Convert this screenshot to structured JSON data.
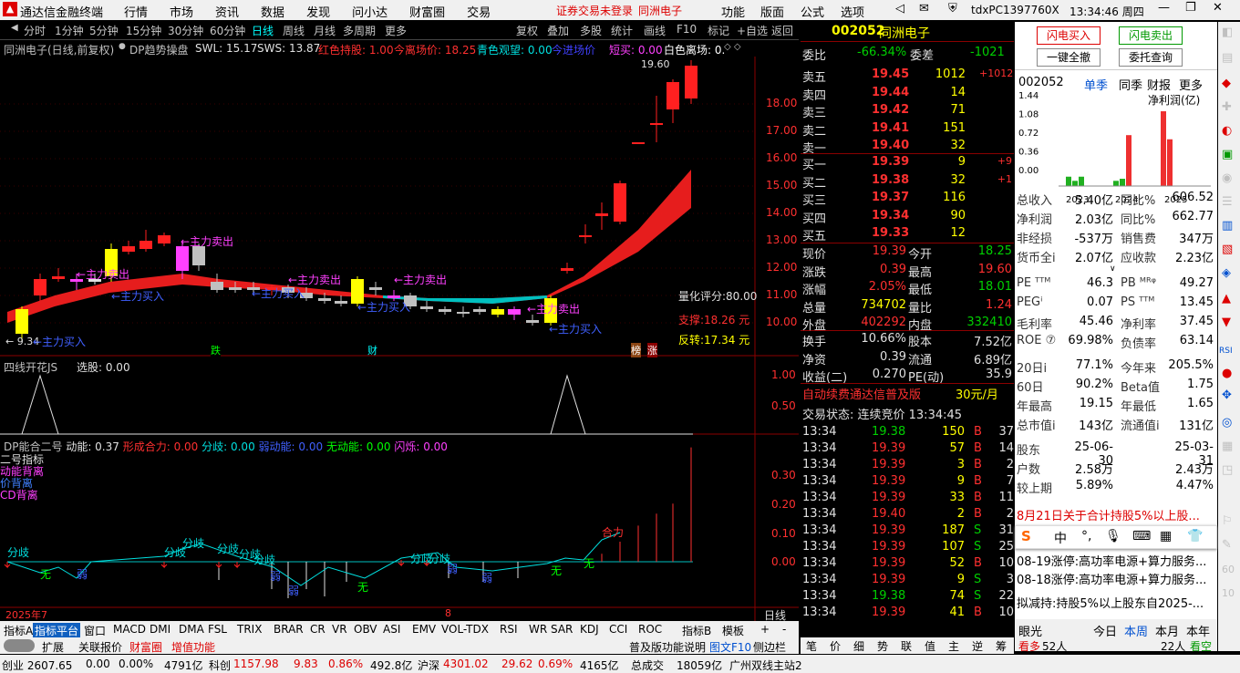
{
  "app": {
    "title": "通达信金融终端",
    "menus": [
      "行情",
      "市场",
      "资讯",
      "数据",
      "发现",
      "问小达",
      "财富圈",
      "交易"
    ],
    "alert": "证券交易未登录",
    "stock_name_top": "同洲电子",
    "right_menus": [
      "功能",
      "版面",
      "公式",
      "选项"
    ],
    "account": "tdxPC1397760X",
    "time": "13:34:46 周四"
  },
  "periods": [
    "分时",
    "1分钟",
    "5分钟",
    "15分钟",
    "30分钟",
    "60分钟",
    "日线",
    "周线",
    "月线",
    "多周期",
    "更多"
  ],
  "toolbar": [
    "复权",
    "叠加",
    "多股",
    "统计",
    "画线",
    "F10",
    "标记",
    "+自选",
    "返回"
  ],
  "chart_info": {
    "name": "同洲电子(日线,前复权)",
    "indicator": "DP趋势操盘",
    "swl": "SWL: 15.17",
    "sws": "SWS: 13.87",
    "red_hold": "红色持股: 1.00",
    "today_price": "今离场价: 18.25",
    "cyan_watch": "青色观望: 0.00",
    "today_entry": "今进场价",
    "short_buy": "短买: 0.00",
    "white_exit": "白色离场: 0."
  },
  "main_labels": {
    "score": "量化评分:80.00",
    "support": "支撑:18.26 元",
    "reverse": "反转:17.34 元",
    "low_label": "← 9.34",
    "high_label": "19.60",
    "die": "跌",
    "cai": "财",
    "bang": "榜",
    "zhang": "涨",
    "sell": "←主力卖出",
    "buy": "←主力买入"
  },
  "price_axis": [
    "18.00",
    "17.00",
    "16.00",
    "15.00",
    "14.00",
    "13.00",
    "12.00",
    "11.00",
    "10.00"
  ],
  "ind1": {
    "title": "四线开花JS",
    "sel": "选股: 0.00",
    "axis": [
      "1.00",
      "0.50"
    ]
  },
  "ind2": {
    "title": "DP能合二号",
    "power": "动能: 0.37",
    "form": "形成合力: 0.00",
    "diverge": "分歧: 0.00",
    "weak": "弱动能: 0.00",
    "none": "无动能: 0.00",
    "flash": "闪烁: 0.00",
    "axis": [
      "0.30",
      "0.20",
      "0.10",
      "0.00"
    ],
    "legend": [
      "二号指标",
      "动能背离",
      "价背离",
      "CD背离"
    ],
    "labels": {
      "fq": "分歧",
      "w": "无",
      "r": "弱",
      "hl": "合力"
    }
  },
  "date_axis": {
    "d1": "2025年7",
    "d2": "8",
    "period": "日线"
  },
  "quote": {
    "code": "002052",
    "name": "同洲电子",
    "weibi_label": "委比",
    "weibi": "-66.34%",
    "weicha_label": "委差",
    "weicha": "-1021",
    "asks": [
      {
        "l": "卖五",
        "p": "19.45",
        "v": "1012",
        "c": "+1012"
      },
      {
        "l": "卖四",
        "p": "19.44",
        "v": "14",
        "c": ""
      },
      {
        "l": "卖三",
        "p": "19.42",
        "v": "71",
        "c": ""
      },
      {
        "l": "卖二",
        "p": "19.41",
        "v": "151",
        "c": ""
      },
      {
        "l": "卖一",
        "p": "19.40",
        "v": "32",
        "c": ""
      }
    ],
    "bids": [
      {
        "l": "买一",
        "p": "19.39",
        "v": "9",
        "c": "+9"
      },
      {
        "l": "买二",
        "p": "19.38",
        "v": "32",
        "c": "+1"
      },
      {
        "l": "买三",
        "p": "19.37",
        "v": "116",
        "c": ""
      },
      {
        "l": "买四",
        "p": "19.34",
        "v": "90",
        "c": ""
      },
      {
        "l": "买五",
        "p": "19.33",
        "v": "12",
        "c": ""
      }
    ],
    "stats": [
      [
        "现价",
        "19.39",
        "今开",
        "18.25"
      ],
      [
        "涨跌",
        "0.39",
        "最高",
        "19.60"
      ],
      [
        "涨幅",
        "2.05%",
        "最低",
        "18.01"
      ],
      [
        "总量",
        "734702",
        "量比",
        "1.24"
      ],
      [
        "外盘",
        "402292",
        "内盘",
        "332410"
      ]
    ],
    "stats2": [
      [
        "换手",
        "10.66%",
        "股本",
        "7.52亿"
      ],
      [
        "净资",
        "0.39",
        "流通",
        "6.89亿"
      ],
      [
        "收益(二)",
        "0.270",
        "PE(动)",
        "35.9"
      ]
    ],
    "ad": "自动续费通达信普及版",
    "ad_price": "30元/月",
    "trade_state": "交易状态: 连续竞价 13:34:45",
    "ticks": [
      [
        "13:34",
        "19.38",
        "150",
        "B",
        "37"
      ],
      [
        "13:34",
        "19.39",
        "57",
        "B",
        "14"
      ],
      [
        "13:34",
        "19.39",
        "3",
        "B",
        "2"
      ],
      [
        "13:34",
        "19.39",
        "9",
        "B",
        "7"
      ],
      [
        "13:34",
        "19.39",
        "33",
        "B",
        "11"
      ],
      [
        "13:34",
        "19.40",
        "2",
        "B",
        "2"
      ],
      [
        "13:34",
        "19.39",
        "187",
        "S",
        "31"
      ],
      [
        "13:34",
        "19.39",
        "107",
        "S",
        "25"
      ],
      [
        "13:34",
        "19.39",
        "52",
        "B",
        "10"
      ],
      [
        "13:34",
        "19.39",
        "9",
        "S",
        "3"
      ],
      [
        "13:34",
        "19.38",
        "74",
        "S",
        "22"
      ],
      [
        "13:34",
        "19.39",
        "41",
        "B",
        "10"
      ]
    ],
    "tabs": [
      "笔",
      "价",
      "细",
      "势",
      "联",
      "值",
      "主",
      "逆",
      "筹"
    ]
  },
  "fin": {
    "btn_buy": "闪电买入",
    "btn_sell": "闪电卖出",
    "btn_cancel": "一键全撤",
    "btn_query": "委托查询",
    "code": "002052",
    "tabs": [
      "单季",
      "同季",
      "财报",
      "更多"
    ],
    "chart_title": "净利润(亿)",
    "yaxis": [
      "1.44",
      "1.08",
      "0.72",
      "0.36",
      "0.00"
    ],
    "years": [
      "2023",
      "2024",
      "2025"
    ],
    "chart_data": {
      "type": "bar",
      "title": "净利润(亿)",
      "categories": [
        "2023Q1",
        "2023Q2",
        "2023Q3",
        "2023Q4",
        "2024Q1",
        "2024Q2",
        "2024Q3",
        "2024Q4",
        "2025Q1",
        "2025Q2"
      ],
      "values": [
        0.18,
        0.1,
        0.18,
        0.0,
        0.1,
        0.14,
        0.98,
        0.0,
        1.44,
        0.9
      ],
      "ylim": [
        0,
        1.44
      ]
    },
    "rows": [
      [
        "总收入",
        "5.40亿",
        "同比%",
        "606.52"
      ],
      [
        "净利润",
        "2.03亿",
        "同比%",
        "662.77"
      ],
      [
        "非经损",
        "-537万",
        "销售费",
        "347万"
      ],
      [
        "货币全i",
        "2.07亿",
        "应收款",
        "2.23亿"
      ],
      [
        "PE ᵀᵀᴹ",
        "46.3",
        "PB ᴹᴿᵠ",
        "49.27"
      ],
      [
        "PEGⁱ",
        "0.07",
        "PS ᵀᵀᴹ",
        "13.45"
      ],
      [
        "毛利率",
        "45.46",
        "净利率",
        "37.45"
      ],
      [
        "ROE ⑦",
        "69.98%",
        "负债率",
        "63.14"
      ],
      [
        "20日i",
        "77.1%",
        "今年来",
        "205.5%"
      ],
      [
        "60日",
        "90.2%",
        "Beta值",
        "1.75"
      ],
      [
        "年最高",
        "19.15",
        "年最低",
        "1.65"
      ],
      [
        "总市值i",
        "143亿",
        "流通值i",
        "131亿"
      ],
      [
        "股东",
        "25-06-30",
        "",
        "25-03-31"
      ],
      [
        "户数",
        "2.58万",
        "",
        "2.43万"
      ],
      [
        "较上期",
        "5.89%",
        "",
        "4.47%"
      ]
    ],
    "news": [
      "8月21日关于合计持股5%以上股...",
      "08-19涨停:高功率电源+算力服务...",
      "08-18涨停:高功率电源+算力服务...",
      "拟减持:持股5%以上股东自2025-..."
    ],
    "bottom": {
      "l": "眼光",
      "t": "今日",
      "w": "本周",
      "m": "本月",
      "y": "本年",
      "more": "看多",
      "num": "52人",
      "num2": "22人",
      "empty": "看空"
    }
  },
  "bottom_tabs": [
    "指标A",
    "指标平台",
    "窗口",
    "MACD",
    "DMI",
    "DMA",
    "FSL",
    "TRIX",
    "BRAR",
    "CR",
    "VR",
    "OBV",
    "ASI",
    "EMV",
    "VOL-TDX",
    "RSI",
    "WR",
    "SAR",
    "KDJ",
    "CCI",
    "ROC",
    "指标B",
    "模板",
    "+",
    "-"
  ],
  "bottom2": [
    "扩展",
    "关联报价",
    "财富圈",
    "增值功能"
  ],
  "bottom2_right": [
    "普及版功能说明",
    "图文F10",
    "侧边栏"
  ],
  "status": {
    "a": "创业 2607.65",
    "b": "0.00",
    "c": "0.00%",
    "d": "4791亿",
    "e": "科创",
    "f": "1157.98",
    "g": "9.83",
    "h": "0.86%",
    "i": "492.8亿",
    "j": "沪深",
    "k": "4301.02",
    "l": "29.62",
    "m": "0.69%",
    "n": "4165亿",
    "o": "总成交",
    "p": "18059亿",
    "q": "广州双线主站2"
  },
  "rtool": [
    "RSI",
    "60",
    "10"
  ]
}
